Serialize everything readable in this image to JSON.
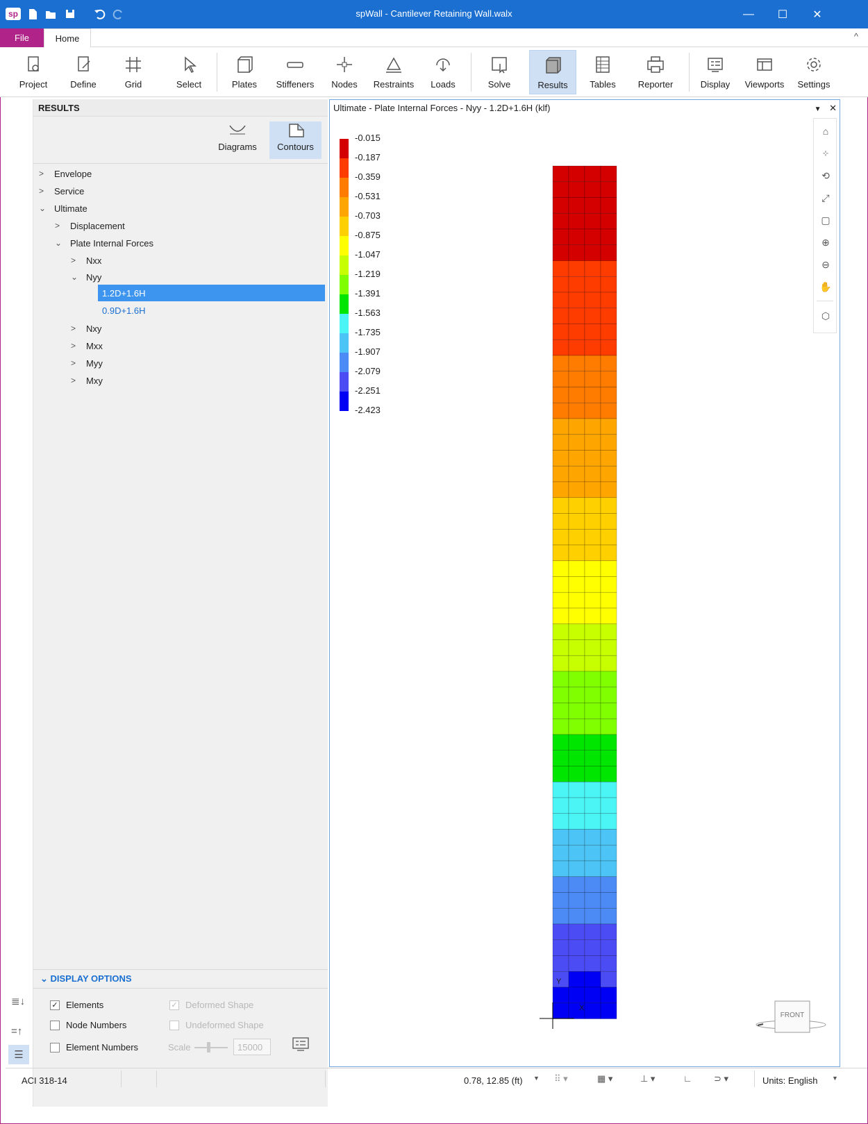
{
  "app": {
    "title": "spWall - Cantilever Retaining Wall.walx",
    "logo": "sp"
  },
  "window_controls": {
    "minimize": "—",
    "maximize": "☐",
    "close": "✕"
  },
  "menu": {
    "file": "File",
    "home": "Home",
    "collapse": "^"
  },
  "ribbon": {
    "project": "Project",
    "define": "Define",
    "grid": "Grid",
    "select": "Select",
    "plates": "Plates",
    "stiffeners": "Stiffeners",
    "nodes": "Nodes",
    "restraints": "Restraints",
    "loads": "Loads",
    "solve": "Solve",
    "results": "Results",
    "tables": "Tables",
    "reporter": "Reporter",
    "display": "Display",
    "viewports": "Viewports",
    "settings": "Settings"
  },
  "panel": {
    "header": "RESULTS",
    "modes": {
      "diagrams": "Diagrams",
      "contours": "Contours"
    },
    "tree": {
      "envelope": "Envelope",
      "service": "Service",
      "ultimate": "Ultimate",
      "displacement": "Displacement",
      "plate_internal_forces": "Plate Internal Forces",
      "nxx": "Nxx",
      "nyy": "Nyy",
      "combo1": "1.2D+1.6H",
      "combo2": "0.9D+1.6H",
      "nxy": "Nxy",
      "mxx": "Mxx",
      "myy": "Myy",
      "mxy": "Mxy"
    },
    "display_options": {
      "header": "DISPLAY OPTIONS",
      "elements": "Elements",
      "node_numbers": "Node Numbers",
      "element_numbers": "Element Numbers",
      "deformed_shape": "Deformed Shape",
      "undeformed_shape": "Undeformed Shape",
      "scale_label": "Scale",
      "scale_value": "15000"
    }
  },
  "viewport": {
    "title": "Ultimate - Plate Internal Forces - Nyy - 1.2D+1.6H (klf)",
    "legend": [
      {
        "label": "-0.015",
        "color": "#d40000"
      },
      {
        "label": "-0.187",
        "color": "#ff3c00"
      },
      {
        "label": "-0.359",
        "color": "#ff7c00"
      },
      {
        "label": "-0.531",
        "color": "#ffa500"
      },
      {
        "label": "-0.703",
        "color": "#ffd000"
      },
      {
        "label": "-0.875",
        "color": "#ffff00"
      },
      {
        "label": "-1.047",
        "color": "#c8ff00"
      },
      {
        "label": "-1.219",
        "color": "#7fff00"
      },
      {
        "label": "-1.391",
        "color": "#00e600"
      },
      {
        "label": "-1.563",
        "color": "#4cf5f5"
      },
      {
        "label": "-1.735",
        "color": "#4cc4f5"
      },
      {
        "label": "-1.907",
        "color": "#4c8bf5"
      },
      {
        "label": "-2.079",
        "color": "#4c4cf5"
      },
      {
        "label": "-2.251",
        "color": "#0000f5"
      },
      {
        "label": "-2.423",
        "color": ""
      }
    ],
    "axis_y": "Y",
    "axis_x": "X",
    "view_cube": "FRONT"
  },
  "status": {
    "code": "ACI 318-14",
    "coords": "0.78, 12.85 (ft)",
    "units": "Units: English"
  }
}
